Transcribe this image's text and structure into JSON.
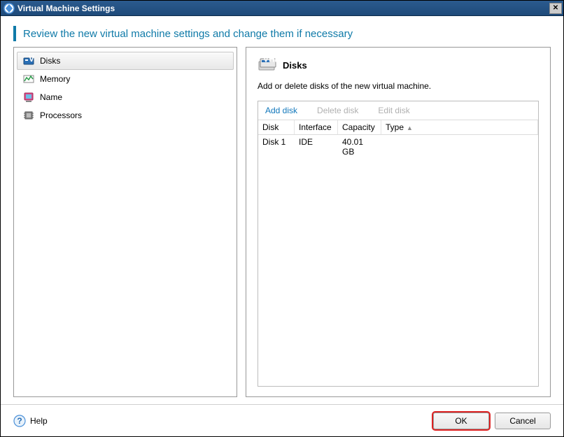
{
  "window": {
    "title": "Virtual Machine Settings",
    "heading": "Review the new virtual machine settings and change them if necessary"
  },
  "nav": {
    "items": [
      {
        "label": "Disks",
        "selected": true
      },
      {
        "label": "Memory",
        "selected": false
      },
      {
        "label": "Name",
        "selected": false
      },
      {
        "label": "Processors",
        "selected": false
      }
    ]
  },
  "detail": {
    "title": "Disks",
    "description": "Add or delete disks of the new virtual machine.",
    "toolbar": {
      "add": "Add disk",
      "delete": "Delete disk",
      "edit": "Edit disk"
    },
    "columns": {
      "disk": "Disk",
      "interface": "Interface",
      "capacity": "Capacity",
      "type": "Type"
    },
    "rows": [
      {
        "disk": "Disk 1",
        "interface": "IDE",
        "capacity": "40.01 GB",
        "type": ""
      }
    ]
  },
  "footer": {
    "help": "Help",
    "ok": "OK",
    "cancel": "Cancel"
  }
}
